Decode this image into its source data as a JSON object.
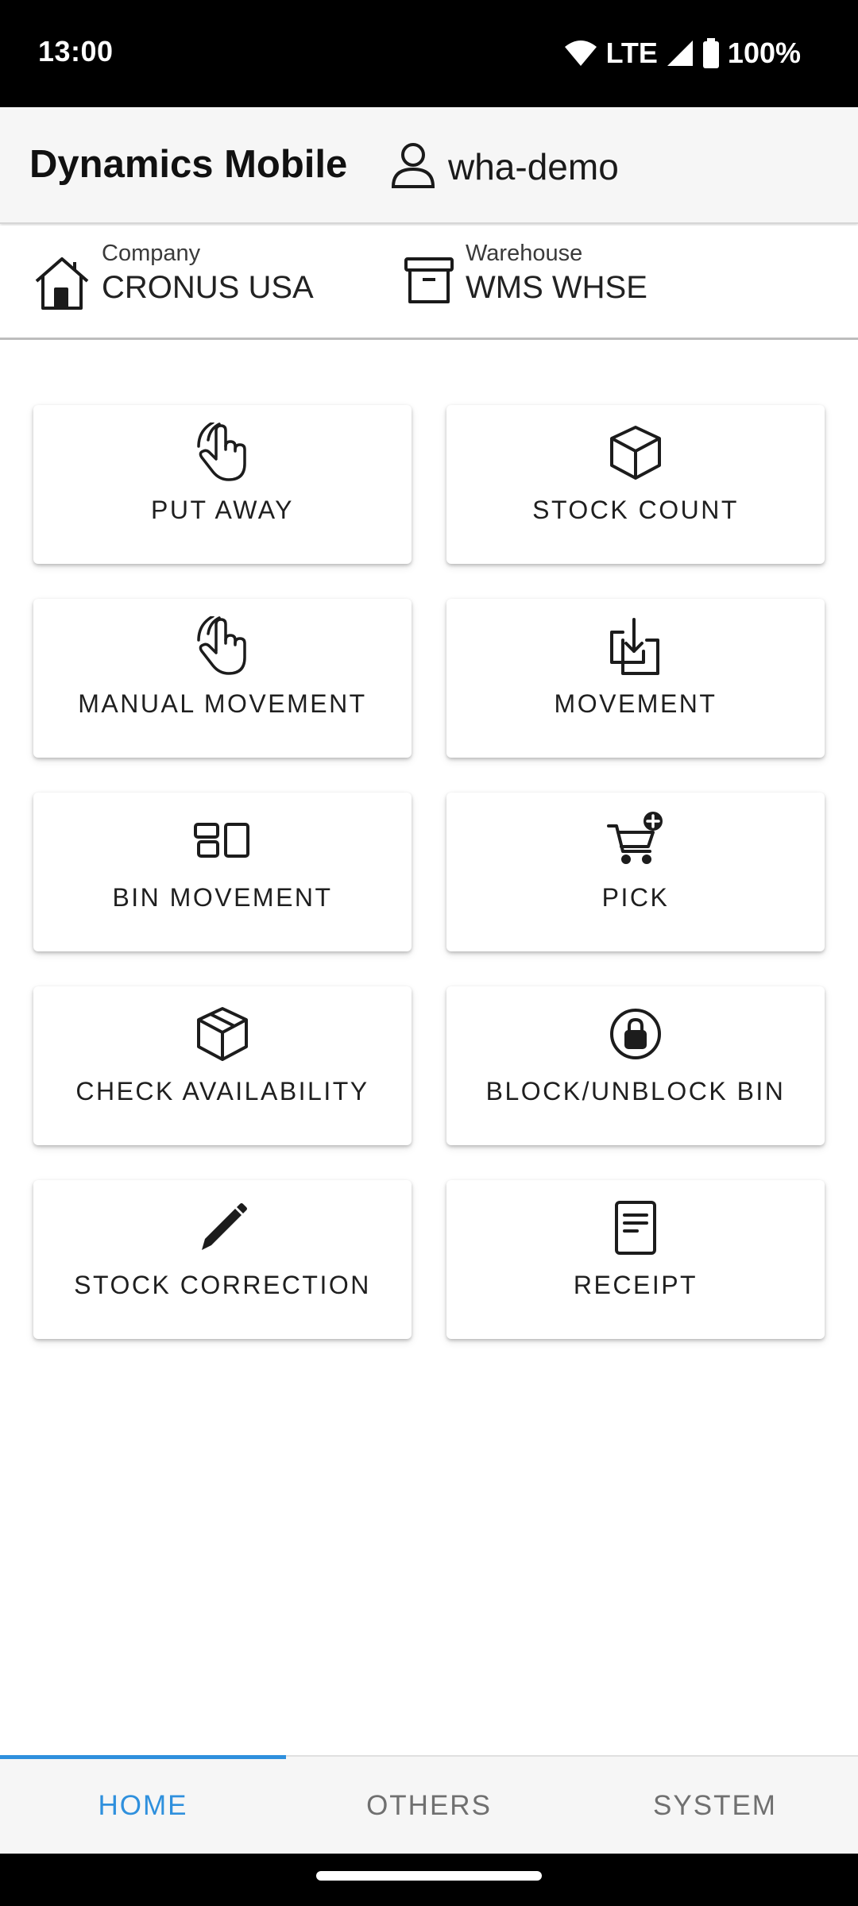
{
  "status_bar": {
    "time": "13:00",
    "network": "LTE",
    "battery": "100%",
    "icons": [
      "wifi-icon",
      "cell-signal-icon",
      "battery-icon"
    ]
  },
  "app_bar": {
    "title": "Dynamics Mobile",
    "user_icon": "person-outline-icon",
    "user": "wha-demo"
  },
  "context": {
    "company_label": "Company",
    "company_value": "CRONUS USA",
    "company_icon": "home-icon",
    "warehouse_label": "Warehouse",
    "warehouse_value": "WMS WHSE",
    "warehouse_icon": "archive-box-icon"
  },
  "tiles": [
    {
      "label": "PUT AWAY",
      "icon": "hand-pointer-icon"
    },
    {
      "label": "STOCK COUNT",
      "icon": "cube-icon"
    },
    {
      "label": "MANUAL MOVEMENT",
      "icon": "hand-pointer-icon"
    },
    {
      "label": "MOVEMENT",
      "icon": "download-tray-icon"
    },
    {
      "label": "BIN MOVEMENT",
      "icon": "bins-icon"
    },
    {
      "label": "PICK",
      "icon": "cart-plus-icon"
    },
    {
      "label": "CHECK AVAILABILITY",
      "icon": "package-icon"
    },
    {
      "label": "BLOCK/UNBLOCK BIN",
      "icon": "lock-circle-icon"
    },
    {
      "label": "STOCK CORRECTION",
      "icon": "pencil-icon"
    },
    {
      "label": "RECEIPT",
      "icon": "receipt-icon"
    }
  ],
  "bottom_nav": {
    "tabs": [
      {
        "label": "HOME",
        "active": true
      },
      {
        "label": "OTHERS",
        "active": false
      },
      {
        "label": "SYSTEM",
        "active": false
      }
    ],
    "accent": "#2f90dd"
  }
}
